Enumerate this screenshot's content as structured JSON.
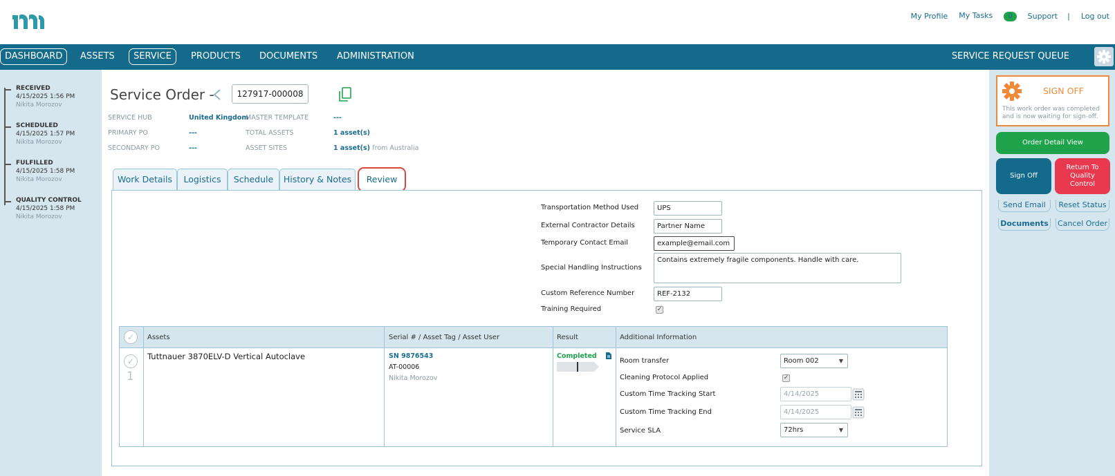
{
  "header": {
    "links": {
      "profile": "My Profile",
      "tasks": "My Tasks",
      "task_count": "0",
      "support": "Support",
      "separator": "|",
      "logout": "Log out"
    }
  },
  "nav": {
    "items": [
      "DASHBOARD",
      "ASSETS",
      "SERVICE",
      "PRODUCTS",
      "DOCUMENTS",
      "ADMINISTRATION"
    ],
    "queue": "SERVICE REQUEST QUEUE"
  },
  "timeline": [
    {
      "title": "RECEIVED",
      "date": "4/15/2025 1:56 PM",
      "user": "Nikita Morozov"
    },
    {
      "title": "SCHEDULED",
      "date": "4/15/2025 1:57 PM",
      "user": "Nikita Morozov"
    },
    {
      "title": "FULFILLED",
      "date": "4/15/2025 1:58 PM",
      "user": "Nikita Morozov"
    },
    {
      "title": "QUALITY CONTROL",
      "date": "4/15/2025 1:58 PM",
      "user": "Nikita Morozov"
    }
  ],
  "order": {
    "title": "Service Order -",
    "number": "127917-000008",
    "meta": {
      "service_hub_label": "SERVICE HUB",
      "service_hub": "United Kingdom",
      "master_template_label": "MASTER TEMPLATE",
      "master_template": "---",
      "primary_po_label": "PRIMARY PO",
      "primary_po": "---",
      "total_assets_label": "TOTAL ASSETS",
      "total_assets": "1 asset(s)",
      "secondary_po_label": "SECONDARY PO",
      "secondary_po": "---",
      "asset_sites_label": "ASSET SITES",
      "asset_sites": "1 asset(s)",
      "asset_sites_from": "from Australia"
    }
  },
  "tabs": [
    "Work Details",
    "Logistics",
    "Schedule",
    "History & Notes",
    "Review"
  ],
  "review_form": {
    "transport_label": "Transportation Method Used",
    "transport_value": "UPS",
    "contractor_label": "External Contractor Details",
    "contractor_value": "Partner Name",
    "email_label": "Temporary Contact Email",
    "email_value": "example@email.com",
    "handling_label": "Special Handling Instructions",
    "handling_value": "Contains extremely fragile components. Handle with care.",
    "reference_label": "Custom Reference Number",
    "reference_value": "REF-2132",
    "training_label": "Training Required",
    "training_checked": true
  },
  "asset_table": {
    "headers": [
      "Assets",
      "Serial # / Asset Tag / Asset User",
      "Result",
      "Additional Information"
    ],
    "row": {
      "index": "1",
      "asset": "Tuttnauer 3870ELV-D Vertical Autoclave",
      "serial": "SN 9876543",
      "tag": "AT-00006",
      "user": "Nikita Morozov",
      "result": "Completed",
      "info": [
        {
          "label": "Room transfer",
          "type": "select",
          "value": "Room 002"
        },
        {
          "label": "Cleaning Protocol Applied",
          "type": "checkbox",
          "value": true
        },
        {
          "label": "Custom Time Tracking Start",
          "type": "date",
          "value": "4/14/2025"
        },
        {
          "label": "Custom Time Tracking End",
          "type": "date",
          "value": "4/14/2025"
        },
        {
          "label": "Service SLA",
          "type": "select",
          "value": "72hrs"
        }
      ]
    }
  },
  "right_panel": {
    "signoff_title": "SIGN OFF",
    "signoff_text_1": "This work order was completed",
    "signoff_text_2": "and is now waiting for sign-off.",
    "order_detail": "Order Detail View",
    "sign_off": "Sign Off",
    "return_qc_1": "Return To",
    "return_qc_2": "Quality",
    "return_qc_3": "Control",
    "send_email": "Send Email",
    "reset_status": "Reset Status",
    "documents": "Documents",
    "cancel_order": "Cancel Order"
  },
  "colors": {
    "nav": "#146a8b",
    "accent_green": "#1ea34a",
    "accent_red": "#e8394f",
    "accent_orange": "#ef8a3a",
    "side_panel": "#d5e6ef"
  }
}
